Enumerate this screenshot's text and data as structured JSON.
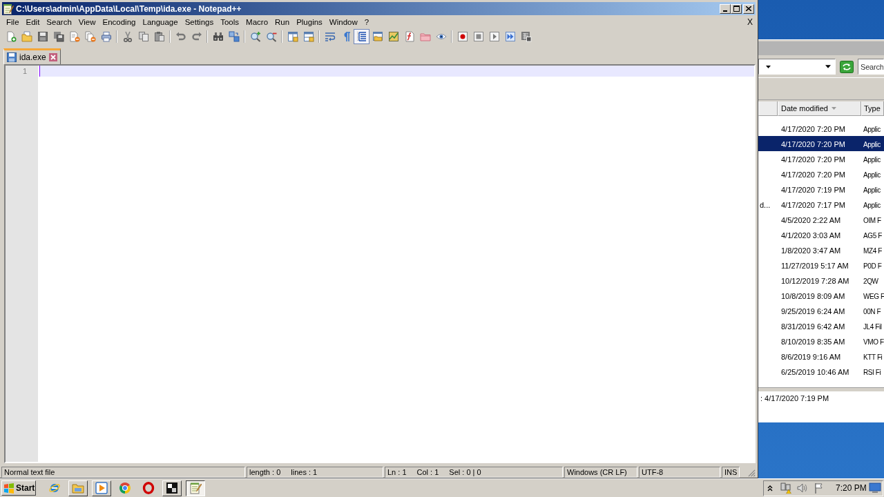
{
  "window": {
    "title": "C:\\Users\\admin\\AppData\\Local\\Temp\\ida.exe - Notepad++"
  },
  "menu": [
    "File",
    "Edit",
    "Search",
    "View",
    "Encoding",
    "Language",
    "Settings",
    "Tools",
    "Macro",
    "Run",
    "Plugins",
    "Window",
    "?"
  ],
  "menu_close": "X",
  "toolbar": [
    [
      {
        "pressed": false
      },
      {
        "pressed": false
      },
      {
        "pressed": false
      },
      {
        "pressed": false
      },
      {
        "pressed": false
      },
      {
        "pressed": false
      },
      {
        "pressed": false
      }
    ],
    [
      {
        "pressed": false
      },
      {
        "pressed": false
      },
      {
        "pressed": false
      }
    ],
    [
      {
        "pressed": false
      },
      {
        "pressed": false
      }
    ],
    [
      {
        "pressed": false
      },
      {
        "pressed": false
      }
    ],
    [
      {
        "pressed": false
      },
      {
        "pressed": false
      }
    ],
    [
      {
        "pressed": false
      },
      {
        "pressed": false
      }
    ],
    [
      {
        "pressed": false
      },
      {
        "pressed": false
      },
      {
        "pressed": true
      },
      {
        "pressed": false
      },
      {
        "pressed": false
      },
      {
        "pressed": false
      },
      {
        "pressed": false
      },
      {
        "pressed": false
      }
    ],
    [
      {
        "pressed": false
      },
      {
        "pressed": false
      },
      {
        "pressed": false
      },
      {
        "pressed": false
      },
      {
        "pressed": false
      }
    ]
  ],
  "tabs": [
    {
      "label": "ida.exe",
      "selected": true
    }
  ],
  "editor": {
    "lines": [
      {
        "number": "1",
        "current": true
      }
    ]
  },
  "status_bar": [
    [
      "Normal text file"
    ],
    [
      "length : 0",
      "lines : 1"
    ],
    [
      "Ln : 1",
      "Col : 1",
      "Sel : 0 | 0"
    ],
    [
      "Windows (CR LF)"
    ],
    [
      "UTF-8"
    ],
    [
      "INS"
    ]
  ],
  "explorer": {
    "search": {
      "placeholder": "Search"
    },
    "columns": [
      {
        "label": "Date modified",
        "sorted": true
      },
      {
        "label": "Type",
        "sorted": false
      }
    ],
    "rows": [
      {
        "date": "4/17/2020 7:20 PM",
        "type": "Applic",
        "selected": false
      },
      {
        "date": "4/17/2020 7:20 PM",
        "type": "Applic",
        "selected": true
      },
      {
        "date": "4/17/2020 7:20 PM",
        "type": "Applic",
        "selected": false
      },
      {
        "date": "4/17/2020 7:20 PM",
        "type": "Applic",
        "selected": false
      },
      {
        "date": "4/17/2020 7:19 PM",
        "type": "Applic",
        "selected": false
      },
      {
        "name": "d...",
        "date": "4/17/2020 7:17 PM",
        "type": "Applic",
        "selected": false
      },
      {
        "date": "4/5/2020 2:22 AM",
        "type": "OIM F",
        "selected": false
      },
      {
        "date": "4/1/2020 3:03 AM",
        "type": "AG5 F",
        "selected": false
      },
      {
        "date": "1/8/2020 3:47 AM",
        "type": "MZ4 F",
        "selected": false
      },
      {
        "date": "11/27/2019 5:17 AM",
        "type": "P0D F",
        "selected": false
      },
      {
        "date": "10/12/2019 7:28 AM",
        "type": "2QW",
        "selected": false
      },
      {
        "date": "10/8/2019 8:09 AM",
        "type": "WEG F",
        "selected": false
      },
      {
        "date": "9/25/2019 6:24 AM",
        "type": "00N F",
        "selected": false
      },
      {
        "date": "8/31/2019 6:42 AM",
        "type": "JL4 Fil",
        "selected": false
      },
      {
        "date": "8/10/2019 8:35 AM",
        "type": "VMO F",
        "selected": false
      },
      {
        "date": "8/6/2019 9:16 AM",
        "type": "KTT Fi",
        "selected": false
      },
      {
        "date": "6/25/2019 10:46 AM",
        "type": "RSI Fi",
        "selected": false
      }
    ],
    "details": ": 4/17/2020 7:19 PM"
  },
  "taskbar": {
    "start": "Start",
    "apps": [
      {
        "running": false,
        "selected": false
      },
      {
        "running": true,
        "selected": false
      },
      {
        "running": true,
        "selected": false
      },
      {
        "running": false,
        "selected": false
      },
      {
        "running": false,
        "selected": false
      },
      {
        "running": true,
        "selected": false
      },
      {
        "running": true,
        "selected": true
      }
    ],
    "clock": "7:20 PM"
  }
}
